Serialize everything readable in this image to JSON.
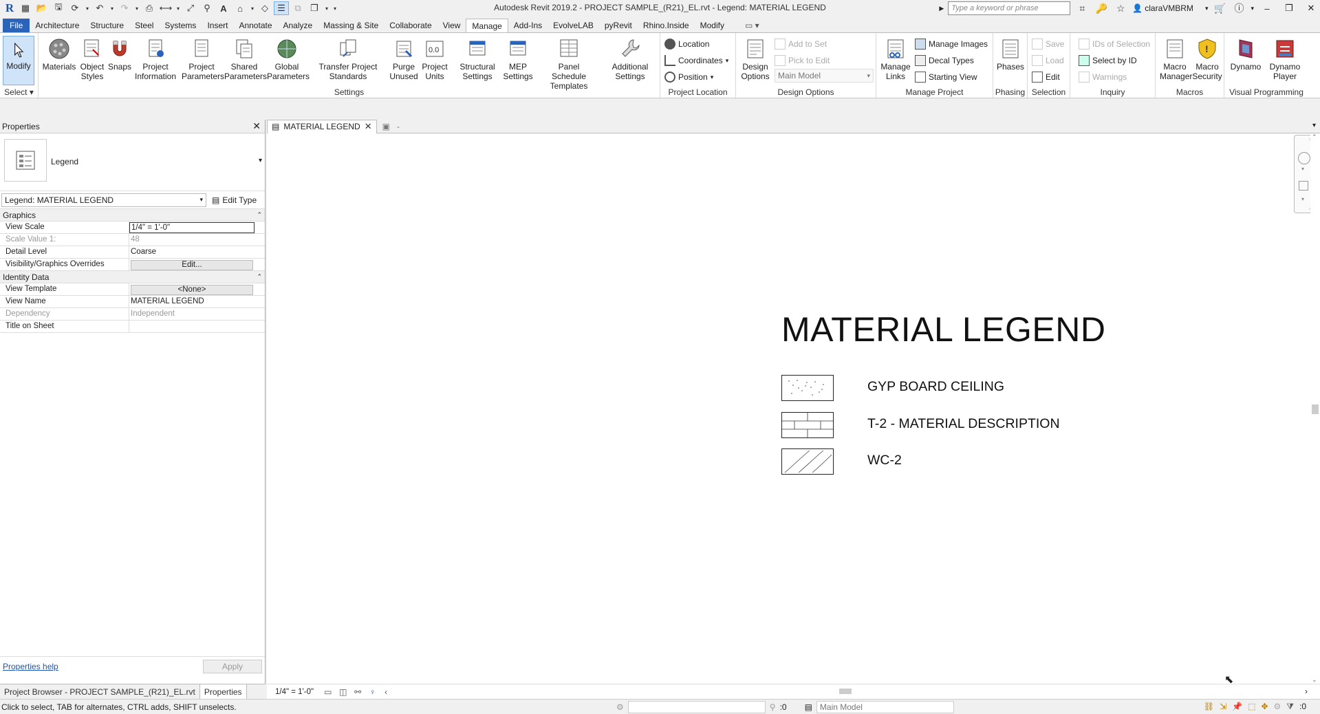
{
  "window": {
    "title": "Autodesk Revit 2019.2 - PROJECT SAMPLE_(R21)_EL.rvt - Legend: MATERIAL LEGEND",
    "search_placeholder": "Type a keyword or phrase",
    "user": "claraVMBRM"
  },
  "menu": {
    "tabs": [
      "File",
      "Architecture",
      "Structure",
      "Steel",
      "Systems",
      "Insert",
      "Annotate",
      "Analyze",
      "Massing & Site",
      "Collaborate",
      "View",
      "Manage",
      "Add-Ins",
      "EvolveLAB",
      "pyRevit",
      "Rhino.Inside",
      "Modify"
    ],
    "active": "Manage"
  },
  "ribbon": {
    "select_panel": {
      "modify": "Modify",
      "title": "Select"
    },
    "settings_panel": {
      "title": "Settings",
      "buttons": [
        "Materials",
        "Object Styles",
        "Snaps",
        "Project Information",
        "Project Parameters",
        "Shared Parameters",
        "Global Parameters",
        "Transfer Project Standards",
        "Purge Unused",
        "Project Units",
        "Structural Settings",
        "MEP Settings",
        "Panel Schedule Templates",
        "Additional Settings"
      ]
    },
    "project_location": {
      "title": "Project Location",
      "location": "Location",
      "coordinates": "Coordinates",
      "position": "Position"
    },
    "design_options": {
      "title": "Design Options",
      "button": "Design Options",
      "add_to_set": "Add to Set",
      "pick_to_edit": "Pick to Edit",
      "main_model": "Main Model"
    },
    "manage_project": {
      "title": "Manage Project",
      "manage_links": "Manage Links",
      "manage_images": "Manage Images",
      "decal_types": "Decal Types",
      "starting_view": "Starting View"
    },
    "phasing": {
      "title": "Phasing",
      "phases": "Phases"
    },
    "selection": {
      "title": "Selection",
      "save": "Save",
      "load": "Load",
      "edit": "Edit"
    },
    "inquiry": {
      "title": "Inquiry",
      "ids_of_selection": "IDs of Selection",
      "select_by_id": "Select by ID",
      "warnings": "Warnings"
    },
    "macros": {
      "title": "Macros",
      "macro_manager": "Macro Manager",
      "macro_security": "Macro Security"
    },
    "visual_programming": {
      "title": "Visual Programming",
      "dynamo": "Dynamo",
      "dynamo_player": "Dynamo Player"
    }
  },
  "properties": {
    "header": "Properties",
    "type_name": "Legend",
    "filter": "Legend: MATERIAL LEGEND",
    "edit_type": "Edit Type",
    "groups": [
      {
        "name": "Graphics",
        "rows": [
          {
            "key": "View Scale",
            "value": "1/4\" = 1'-0\""
          },
          {
            "key": "Scale Value    1:",
            "value": "48"
          },
          {
            "key": "Detail Level",
            "value": "Coarse"
          },
          {
            "key": "Visibility/Graphics Overrides",
            "value": "Edit..."
          }
        ]
      },
      {
        "name": "Identity Data",
        "rows": [
          {
            "key": "View Template",
            "value": "<None>"
          },
          {
            "key": "View Name",
            "value": "MATERIAL LEGEND"
          },
          {
            "key": "Dependency",
            "value": "Independent"
          },
          {
            "key": "Title on Sheet",
            "value": ""
          }
        ]
      }
    ],
    "help_link": "Properties help",
    "apply": "Apply"
  },
  "bottom_tabs": [
    "Project Browser - PROJECT SAMPLE_(R21)_EL.rvt",
    "Properties"
  ],
  "view": {
    "tab_label": "MATERIAL LEGEND",
    "second_tab": "-",
    "scale": "1/4\" = 1'-0\"",
    "legend": {
      "title": "MATERIAL LEGEND",
      "items": [
        "GYP BOARD CEILING",
        "T-2 -  MATERIAL DESCRIPTION",
        "WC-2"
      ]
    }
  },
  "status": {
    "message": "Click to select, TAB for alternates, CTRL adds, SHIFT unselects.",
    "count": ":0",
    "model": "Main Model",
    "filter_count": ":0"
  }
}
